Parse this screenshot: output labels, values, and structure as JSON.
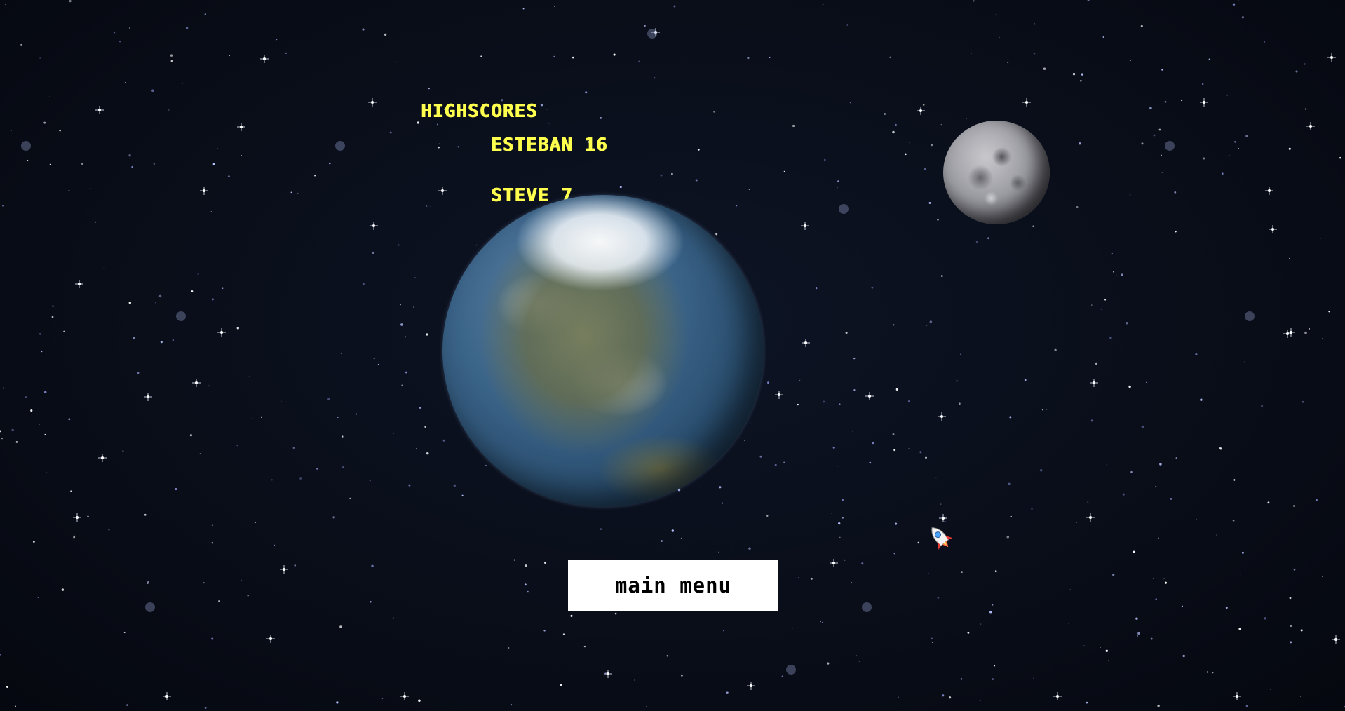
{
  "highscores": {
    "title": "HIGHSCORES",
    "entries": [
      {
        "name": "ESTEBAN",
        "score": 16
      },
      {
        "name": "STEVE",
        "score": 7
      }
    ],
    "color": "#ffff4d"
  },
  "main_menu_button": {
    "label": "MAIN MENU"
  },
  "scene": {
    "background_color": "#0a0f1a",
    "objects": [
      "stars",
      "earth",
      "moon",
      "rocket"
    ]
  },
  "icons": {
    "player": "rocket-icon",
    "planet": "earth",
    "satellite": "moon"
  }
}
